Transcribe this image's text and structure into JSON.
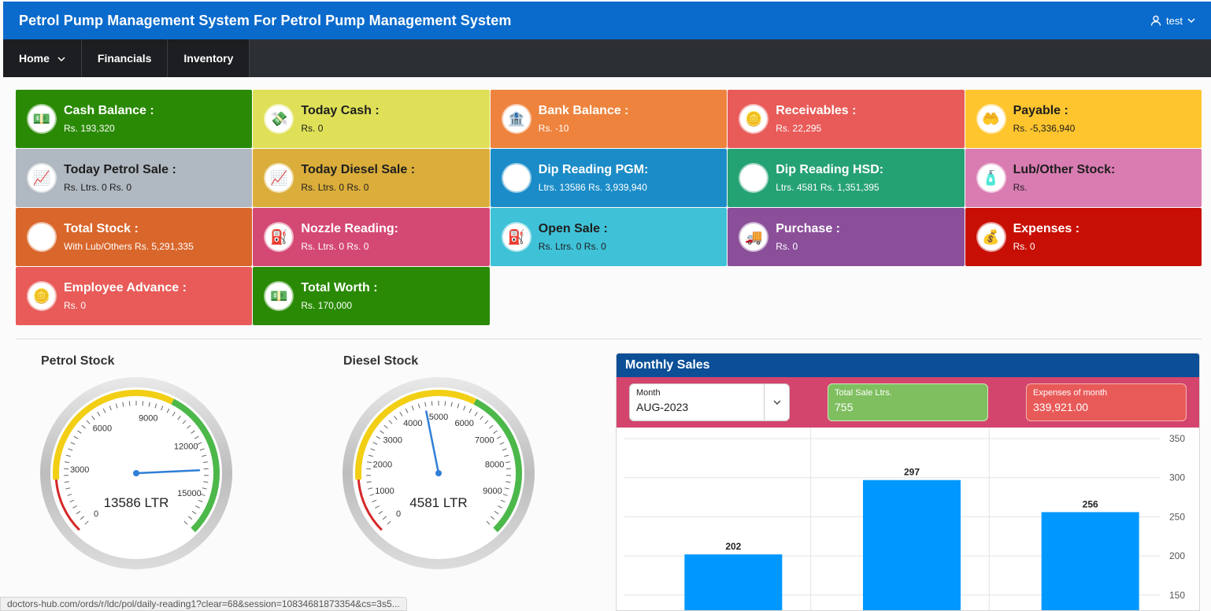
{
  "header": {
    "title": "Petrol Pump Management System For Petrol Pump Management System",
    "user": "test"
  },
  "nav": [
    {
      "label": "Home",
      "dropdown": true
    },
    {
      "label": "Financials",
      "dropdown": false
    },
    {
      "label": "Inventory",
      "dropdown": false
    }
  ],
  "tiles": [
    {
      "title": "Cash Balance :",
      "value": "Rs. 193,320",
      "bg": "#2a8a05",
      "text": "white",
      "icon": "cash-hand-icon",
      "glyph": "💵"
    },
    {
      "title": "Today Cash :",
      "value": "Rs. 0",
      "bg": "#dfe057",
      "text": "dark",
      "icon": "money-hand-icon",
      "glyph": "💸"
    },
    {
      "title": "Bank Balance :",
      "value": "Rs. -10",
      "bg": "#ee833d",
      "text": "white",
      "icon": "bank-icon",
      "glyph": "🏦"
    },
    {
      "title": "Receivables :",
      "value": "Rs. 22,295",
      "bg": "#e85b58",
      "text": "white",
      "icon": "coin-hands-icon",
      "glyph": "🪙"
    },
    {
      "title": "Payable :",
      "value": "Rs. -5,336,940",
      "bg": "#fec52e",
      "text": "dark",
      "icon": "payment-hand-icon",
      "glyph": "🤲"
    },
    {
      "title": "Today Petrol Sale :",
      "value": "Rs. Ltrs. 0 Rs. 0",
      "bg": "#b0b8c1",
      "text": "dark",
      "icon": "growth-chart-icon",
      "glyph": "📈"
    },
    {
      "title": "Today Diesel Sale :",
      "value": "Rs. Ltrs. 0 Rs. 0",
      "bg": "#dbae3b",
      "text": "dark",
      "icon": "growth-chart-icon",
      "glyph": "📈"
    },
    {
      "title": "Dip Reading PGM:",
      "value": "Ltrs. 13586 Rs. 3,939,940",
      "bg": "#1b8cc8",
      "text": "white",
      "icon": "fuel-tank-icon",
      "glyph": "🛢"
    },
    {
      "title": "Dip Reading HSD:",
      "value": "Ltrs. 4581 Rs. 1,351,395",
      "bg": "#25a274",
      "text": "white",
      "icon": "fuel-tank-icon",
      "glyph": "🛢"
    },
    {
      "title": "Lub/Other Stock:",
      "value": "Rs.",
      "bg": "#d97cb1",
      "text": "dark",
      "icon": "oil-can-icon",
      "glyph": "🧴"
    },
    {
      "title": "Total Stock :",
      "value": "With Lub/Others Rs. 5,291,335",
      "bg": "#d9662b",
      "text": "white",
      "icon": "barrel-icon",
      "glyph": "🛢"
    },
    {
      "title": "Nozzle Reading:",
      "value": "Rs. Ltrs. 0 Rs. 0",
      "bg": "#d44874",
      "text": "white",
      "icon": "fuel-nozzle-icon",
      "glyph": "⛽"
    },
    {
      "title": "Open Sale :",
      "value": "Rs. Ltrs. 0 Rs. 0",
      "bg": "#3fc2d8",
      "text": "dark",
      "icon": "fuel-pump-icon",
      "glyph": "⛽"
    },
    {
      "title": "Purchase :",
      "value": "Rs. 0",
      "bg": "#8b4f9a",
      "text": "white",
      "icon": "tanker-truck-icon",
      "glyph": "🚚"
    },
    {
      "title": "Expenses :",
      "value": "Rs. 0",
      "bg": "#c80f05",
      "text": "white",
      "icon": "money-icon",
      "glyph": "💰"
    },
    {
      "title": "Employee Advance :",
      "value": "Rs. 0",
      "bg": "#e85b58",
      "text": "white",
      "icon": "coin-hands-icon",
      "glyph": "🪙"
    },
    {
      "title": "Total Worth :",
      "value": "Rs. 170,000",
      "bg": "#2a8a05",
      "text": "white",
      "icon": "cash-hand-icon",
      "glyph": "💵"
    }
  ],
  "gauges": [
    {
      "title": "Petrol Stock",
      "value": 13586,
      "max": 16500,
      "readout": "13586 LTR",
      "ticks": [
        "0",
        "3000",
        "6000",
        "9000",
        "12000",
        "15000"
      ],
      "tick_values": [
        0,
        3000,
        6000,
        9000,
        12000,
        15000
      ]
    },
    {
      "title": "Diesel Stock",
      "value": 4581,
      "max": 10000,
      "readout": "4581 LTR",
      "ticks": [
        "0",
        "1000",
        "2000",
        "3000",
        "4000",
        "5000",
        "6000",
        "7000",
        "8000",
        "9000"
      ],
      "tick_values": [
        0,
        1000,
        2000,
        3000,
        4000,
        5000,
        6000,
        7000,
        8000,
        9000
      ]
    }
  ],
  "monthly_sales": {
    "title": "Monthly Sales",
    "month_label": "Month",
    "month_value": "AUG-2023",
    "sale_label": "Total Sale Ltrs.",
    "sale_value": "755",
    "expense_label": "Expenses of month",
    "expense_value": "339,921.00"
  },
  "chart_data": {
    "type": "bar",
    "values": [
      202,
      297,
      256
    ],
    "data_labels": [
      "202",
      "297",
      "256"
    ],
    "y_ticks": [
      "350",
      "300",
      "250",
      "200",
      "150"
    ],
    "ylim": [
      150,
      350
    ],
    "grid": true,
    "bar_color": "#0098ff"
  },
  "status_url": "doctors-hub.com/ords/r/ldc/pol/daily-reading1?clear=68&session=10834681873354&cs=3s5..."
}
